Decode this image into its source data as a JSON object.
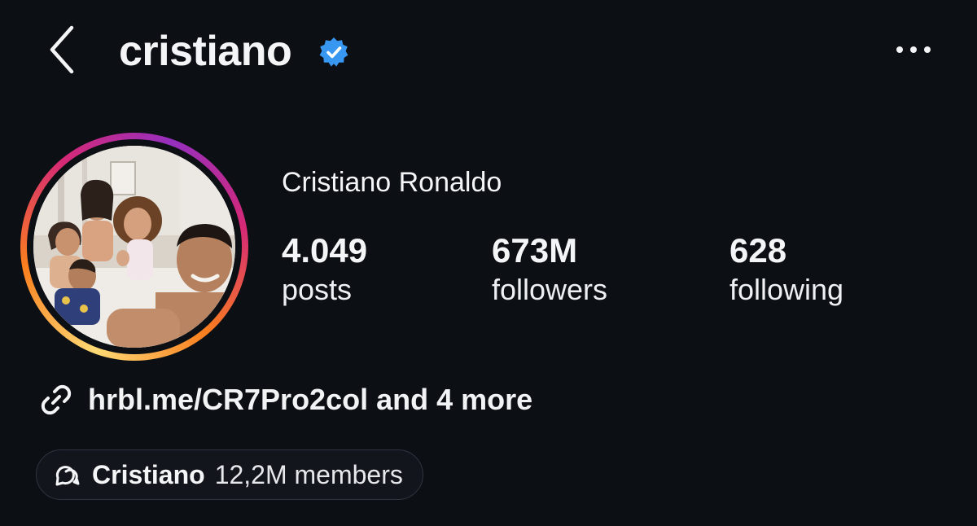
{
  "header": {
    "username": "cristiano",
    "verified": true,
    "back_icon": "chevron-left-icon",
    "more_icon": "more-horizontal-icon"
  },
  "profile": {
    "display_name": "Cristiano Ronaldo",
    "avatar_ring_colors": [
      "#feda75",
      "#fa7e1e",
      "#d62976",
      "#962fbf"
    ]
  },
  "stats": {
    "posts": {
      "value": "4.049",
      "label": "posts"
    },
    "followers": {
      "value": "673M",
      "label": "followers"
    },
    "following": {
      "value": "628",
      "label": "following"
    }
  },
  "link": {
    "icon": "link-icon",
    "text": "hrbl.me/CR7Pro2col and 4 more"
  },
  "channel": {
    "icon": "broadcast-channel-icon",
    "name": "Cristiano",
    "members": "12,2M members"
  },
  "colors": {
    "background": "#0c0f14",
    "verified_badge": "#3897f0",
    "text": "#f4f5f7"
  }
}
